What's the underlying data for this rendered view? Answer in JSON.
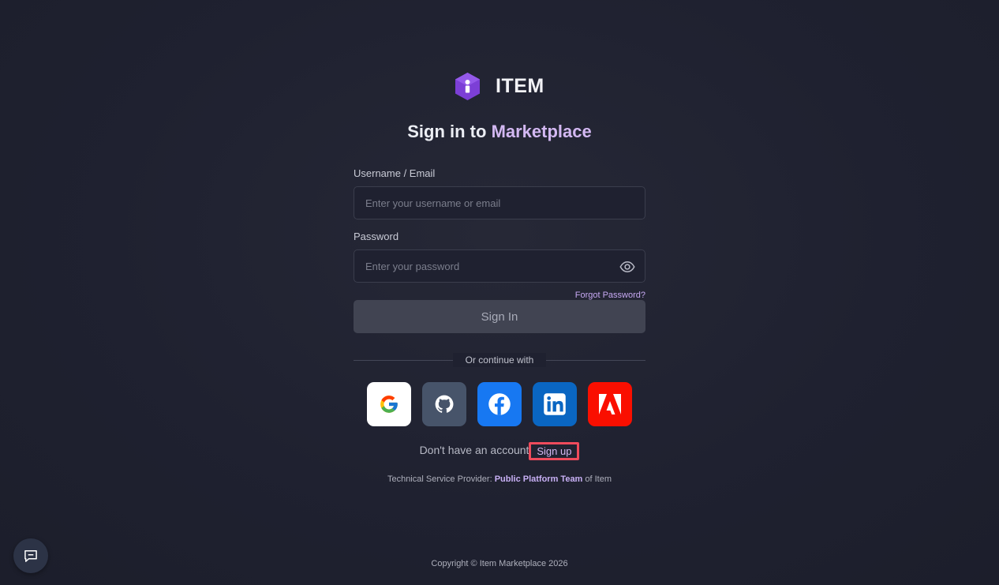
{
  "brand": {
    "name": "ITEM"
  },
  "heading": {
    "prefix": "Sign in to ",
    "accent": "Marketplace"
  },
  "form": {
    "username_label": "Username / Email",
    "username_placeholder": "Enter your username or email",
    "username_value": "",
    "password_label": "Password",
    "password_placeholder": "Enter your password",
    "password_value": "",
    "forgot_label": "Forgot Password?",
    "submit_label": "Sign In"
  },
  "divider": {
    "text": "Or continue with"
  },
  "socials": [
    {
      "name": "Google",
      "icon": "google-icon"
    },
    {
      "name": "GitHub",
      "icon": "github-icon"
    },
    {
      "name": "Facebook",
      "icon": "facebook-icon"
    },
    {
      "name": "LinkedIn",
      "icon": "linkedin-icon"
    },
    {
      "name": "Adobe",
      "icon": "adobe-icon"
    }
  ],
  "signup": {
    "prompt": "Don't have an account",
    "link": "Sign up"
  },
  "provider": {
    "prefix": "Technical Service Provider: ",
    "team": "Public Platform Team",
    "suffix": " of Item"
  },
  "footer": {
    "copyright": "Copyright © Item Marketplace 2026"
  },
  "colors": {
    "accent": "#d3b8f2",
    "background": "#1f2130",
    "highlight": "#ef4b5c"
  }
}
